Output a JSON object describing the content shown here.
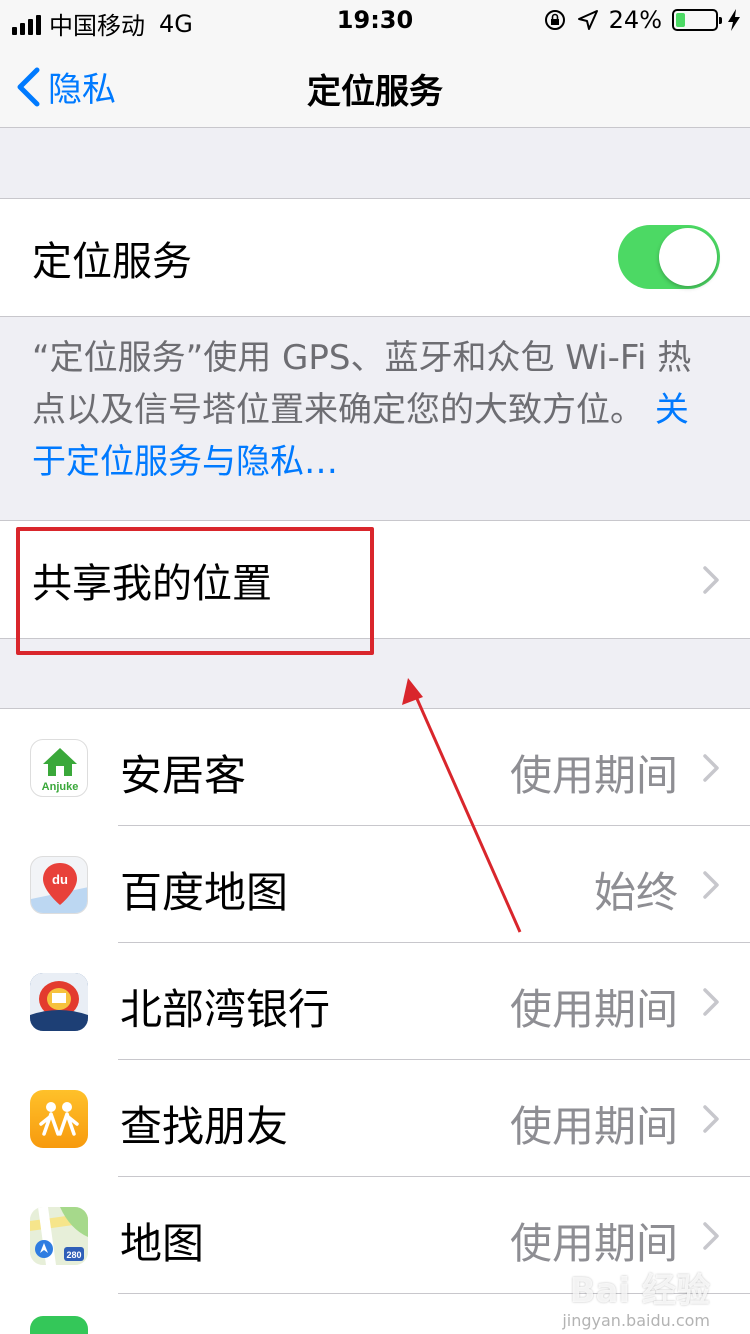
{
  "status_bar": {
    "carrier": "中国移动",
    "network": "4G",
    "time": "19:30",
    "battery_percent_text": "24%",
    "battery_level": 0.24
  },
  "nav": {
    "back_label": "隐私",
    "title": "定位服务"
  },
  "location_toggle": {
    "label": "定位服务",
    "on": true
  },
  "footer": {
    "description": "“定位服务”使用 GPS、蓝牙和众包 Wi-Fi 热点以及信号塔位置来确定您的大致方位。",
    "link_text": "关于定位服务与隐私…"
  },
  "share_location": {
    "label": "共享我的位置"
  },
  "apps": [
    {
      "name": "安居客",
      "permission": "使用期间",
      "icon": "anjuke-icon",
      "icon_text": "Anjuke"
    },
    {
      "name": "百度地图",
      "permission": "始终",
      "icon": "baidu-map-icon",
      "icon_text": "du"
    },
    {
      "name": "北部湾银行",
      "permission": "使用期间",
      "icon": "beibuwan-bank-icon"
    },
    {
      "name": "查找朋友",
      "permission": "使用期间",
      "icon": "find-friends-icon"
    },
    {
      "name": "地图",
      "permission": "使用期间",
      "icon": "maps-icon",
      "icon_text": "280"
    }
  ],
  "colors": {
    "accent": "#007aff",
    "toggle_on": "#4cd964",
    "annotation": "#d9262c"
  },
  "watermark": {
    "brand": "Bai 经验",
    "url": "jingyan.baidu.com"
  }
}
